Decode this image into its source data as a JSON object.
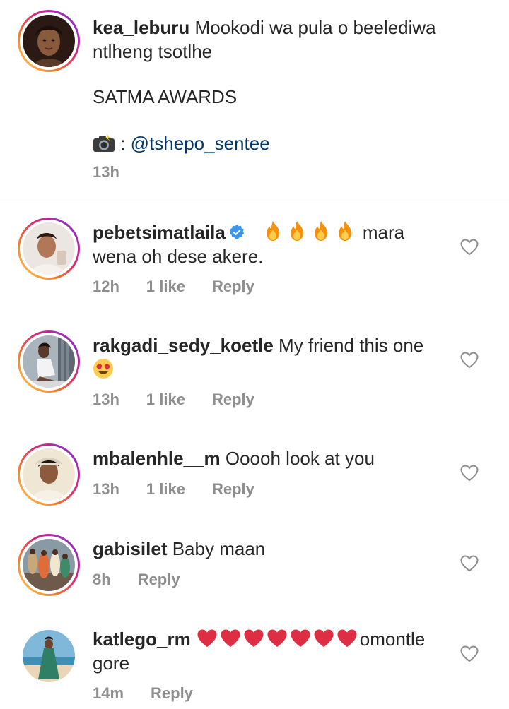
{
  "caption": {
    "username": "kea_leburu",
    "line1": "Mookodi wa pula o beelediwa",
    "line2": "ntlheng tsotlhe",
    "line3": "SATMA AWARDS",
    "camera_icon": "camera-flash-emoji",
    "credit_separator": " : ",
    "mention": "@tshepo_sentee",
    "time": "13h"
  },
  "comments": [
    {
      "username": "pebetsimatlaila",
      "verified": true,
      "emoji": "fire x4",
      "text_line1_suffix": "mara",
      "text_line2": "wena oh dese akere.",
      "time": "12h",
      "likes": "1 like",
      "reply": "Reply"
    },
    {
      "username": "rakgadi_sedy_koetle",
      "text": "My friend this one",
      "emoji": "heart-eyes",
      "time": "13h",
      "likes": "1 like",
      "reply": "Reply"
    },
    {
      "username": "mbalenhle__m",
      "text": "Ooooh look at you",
      "time": "13h",
      "likes": "1 like",
      "reply": "Reply"
    },
    {
      "username": "gabisilet",
      "text": "Baby maan",
      "time": "8h",
      "reply": "Reply"
    },
    {
      "username": "katlego_rm",
      "emoji": "red-heart x7",
      "text_line1_suffix": "omontle",
      "text_line2": "gore",
      "time": "14m",
      "reply": "Reply"
    }
  ],
  "colors": {
    "text": "#262626",
    "meta": "#8e8e8e",
    "mention": "#00376b",
    "verified": "#3897f0",
    "divider": "#dbdbdb"
  }
}
